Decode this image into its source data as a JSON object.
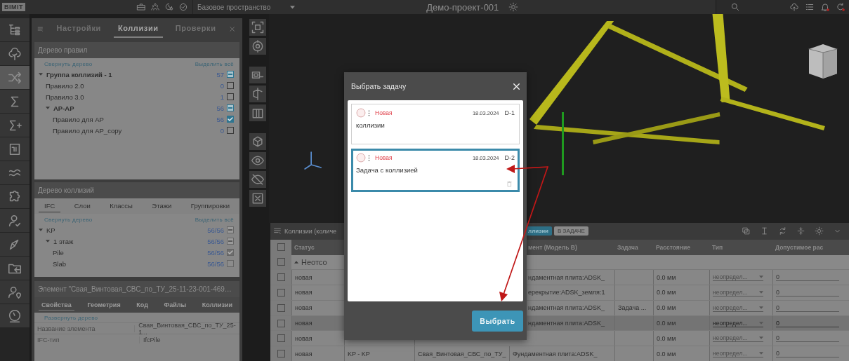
{
  "top_bar": {
    "logo": "BIMIT",
    "workspace": "Базовое пространство",
    "project": "Демо-проект-001"
  },
  "rail": [
    {
      "selected": false
    },
    {
      "selected": false
    },
    {
      "selected": true
    },
    {
      "selected": false
    },
    {
      "selected": false
    },
    {
      "selected": false
    },
    {
      "selected": false
    },
    {
      "selected": false
    },
    {
      "selected": false
    },
    {
      "selected": false
    },
    {
      "selected": false
    },
    {
      "selected": false
    },
    {
      "selected": false
    }
  ],
  "panel": {
    "tabs": [
      {
        "label": "Настройки",
        "selected": false
      },
      {
        "label": "Коллизии",
        "selected": true
      },
      {
        "label": "Проверки",
        "selected": false
      }
    ],
    "rules": {
      "title": "Дерево правил",
      "collapse": "Свернуть дерево",
      "select_all": "Выделить всё",
      "items": [
        {
          "label": "Группа коллизий - 1",
          "count": "57",
          "checked": false,
          "indeterminate": true,
          "expanded": true,
          "children": [
            {
              "label": "Правило 2.0",
              "count": "0",
              "checked": false,
              "indeterminate": false
            },
            {
              "label": "Правило 3.0",
              "count": "1",
              "checked": false,
              "indeterminate": false
            },
            {
              "label": "АР-АР",
              "count": "56",
              "checked": false,
              "indeterminate": true,
              "expanded": true,
              "children": [
                {
                  "label": "Правило для АР",
                  "count": "56",
                  "checked": true,
                  "indeterminate": false
                },
                {
                  "label": "Правило для АР_copy",
                  "count": "0",
                  "checked": false,
                  "indeterminate": false
                }
              ]
            }
          ]
        }
      ]
    },
    "collisions": {
      "title": "Дерево коллизий",
      "tabs": [
        {
          "label": "IFC",
          "selected": true
        },
        {
          "label": "Слои",
          "selected": false
        },
        {
          "label": "Классы",
          "selected": false
        },
        {
          "label": "Этажи",
          "selected": false
        },
        {
          "label": "Группировки",
          "selected": false
        }
      ],
      "collapse": "Свернуть дерево",
      "select_all": "Выделить всё",
      "items": [
        {
          "label": "KP",
          "count": "56/56",
          "checked": false,
          "indeterminate": true,
          "expanded": true,
          "children": [
            {
              "label": "1 этаж",
              "count": "56/56",
              "checked": false,
              "indeterminate": true,
              "expanded": true,
              "children": [
                {
                  "label": "Pile",
                  "count": "56/56",
                  "checked": true,
                  "indeterminate": false
                },
                {
                  "label": "Slab",
                  "count": "56/56",
                  "checked": false,
                  "indeterminate": false
                }
              ]
            }
          ]
        }
      ]
    },
    "element": {
      "title": "Элемент \"Свая_Винтовая_СВС_по_ТУ_25-11-23-001-469…",
      "tabs": [
        {
          "label": "Свойства",
          "selected": true
        },
        {
          "label": "Геометрия",
          "selected": false
        },
        {
          "label": "Код",
          "selected": false
        },
        {
          "label": "Файлы",
          "selected": false
        },
        {
          "label": "Коллизии",
          "selected": false
        }
      ],
      "expand": "Развернуть дерево",
      "props": [
        {
          "name": "Название элемента",
          "value": "Свая_Винтовая_СВС_по_ТУ_25-1..."
        },
        {
          "name": "IFC-тип",
          "value": "IfcPile"
        }
      ]
    }
  },
  "table": {
    "title": "Коллизии (количе",
    "chips": [
      {
        "label": "ллизии",
        "selected": true
      },
      {
        "label": "В ЗАДАЧЕ",
        "selected": false
      }
    ],
    "header": {
      "checked": false,
      "status": "Статус",
      "model_b": "мент (Модель B)",
      "task": "Задача",
      "distance": "Расстояние",
      "type": "Тип",
      "tolerance": "Допустимое рас"
    },
    "group": {
      "label": "Неотсо",
      "expanded": true,
      "checked": false
    },
    "rows": [
      {
        "checked": false,
        "selected": false,
        "status": "новая",
        "model_b": "ндаментная плита:ADSK_",
        "distance": "0.0 мм",
        "type": "неопредел...",
        "tolerance": "0"
      },
      {
        "checked": false,
        "selected": false,
        "status": "новая",
        "model_b": "ерекрытие:ADSK_земля:1",
        "distance": "0.0 мм",
        "type": "неопредел...",
        "tolerance": "0"
      },
      {
        "checked": false,
        "selected": false,
        "status": "новая",
        "model_b": "ндаментная плита:ADSK_",
        "task": "Задача ...",
        "distance": "0.0 мм",
        "type": "неопредел...",
        "tolerance": "0"
      },
      {
        "checked": false,
        "selected": true,
        "status": "новая",
        "model_b": "ндаментная плита:ADSK_",
        "distance": "0.0 мм",
        "type": "неопредел...",
        "tolerance": "0"
      },
      {
        "checked": false,
        "selected": false,
        "status": "новая",
        "distance": "0.0 мм",
        "type": "неопредел...",
        "tolerance": "0"
      },
      {
        "checked": false,
        "selected": false,
        "status": "новая",
        "models": "KP - KP",
        "model_a": "Свая_Винтовая_СВС_по_ТУ_",
        "model_b_full": "Фундаментная плита:ADSK_",
        "distance": "0.0 мм",
        "type": "неопредел...",
        "tolerance": "0"
      }
    ]
  },
  "dialog": {
    "title": "Выбрать задачу",
    "tasks": [
      {
        "status": "Новая",
        "date": "18.03.2024",
        "code": "D-1",
        "title": "коллизии",
        "selected": false
      },
      {
        "status": "Новая",
        "date": "18.03.2024",
        "code": "D-2",
        "title": "Задача с коллизией",
        "selected": true
      }
    ],
    "button": "Выбрать"
  }
}
